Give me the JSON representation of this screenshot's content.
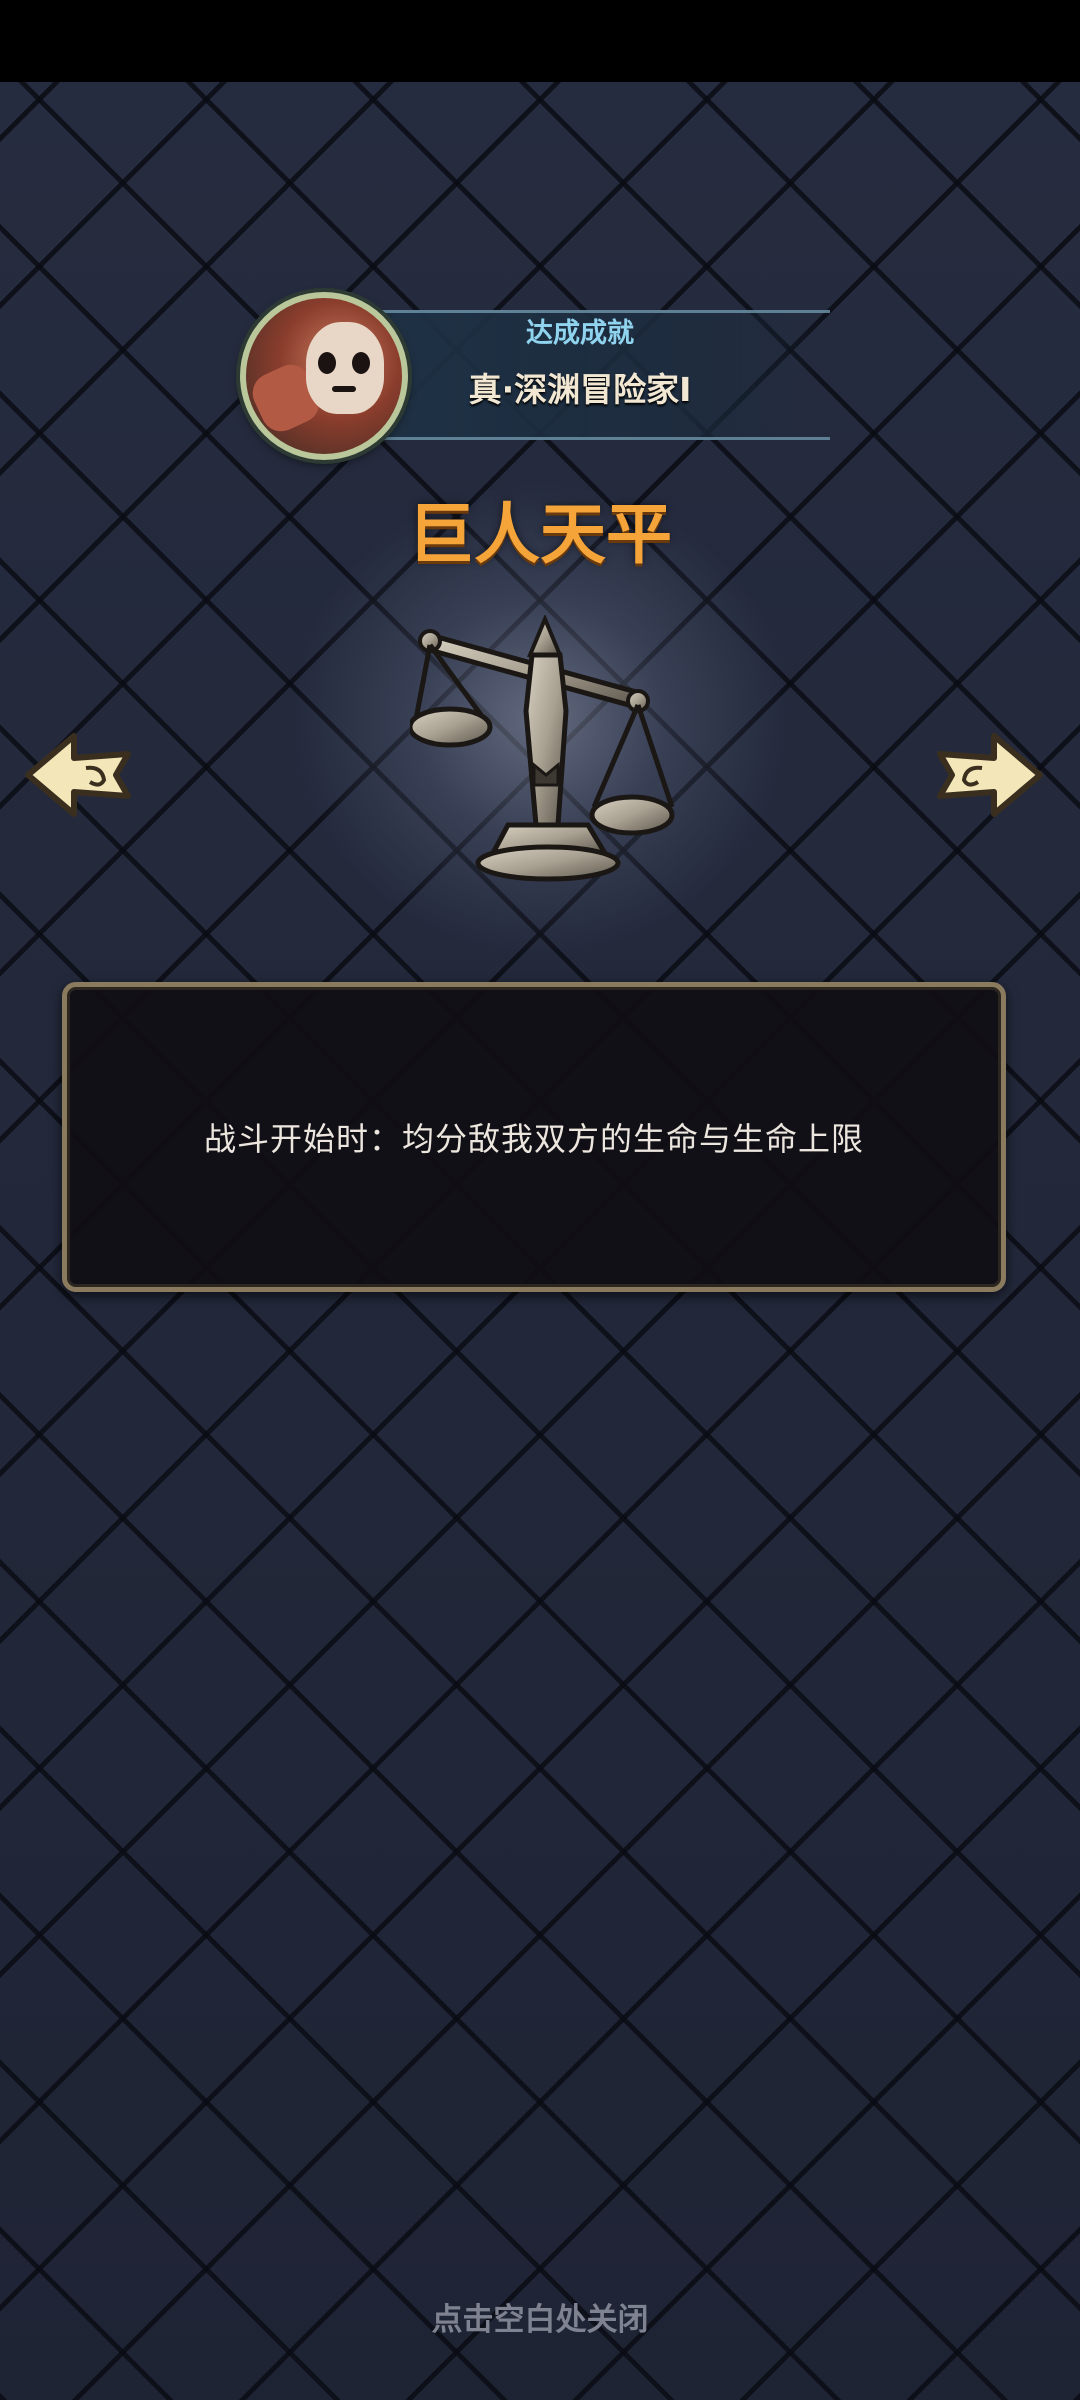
{
  "achievement": {
    "label": "达成成就",
    "title": "真·深渊冒险家I"
  },
  "relic": {
    "name": "巨人天平",
    "icon": "balance-scale-icon",
    "description": "战斗开始时：均分敌我双方的生命与生命上限"
  },
  "navigation": {
    "prev_icon": "arrow-left-icon",
    "next_icon": "arrow-right-icon"
  },
  "footer": {
    "close_hint": "点击空白处关闭"
  },
  "colors": {
    "relic_name": "#f5a43a",
    "achievement_label": "#8fd3ee",
    "box_border": "#8a7a5e"
  }
}
